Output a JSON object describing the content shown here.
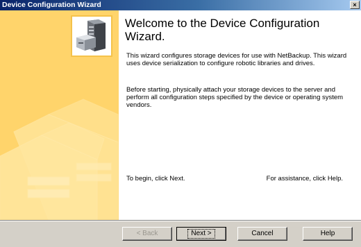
{
  "window": {
    "title": "Device Configuration Wizard",
    "close_label": "×"
  },
  "content": {
    "heading": "Welcome to the Device Configuration Wizard.",
    "paragraph1": "This wizard configures storage devices for use with NetBackup. This wizard uses device serialization to configure robotic libraries and drives.",
    "paragraph2": "Before starting, physically attach your storage devices to the server and perform all configuration steps specified by the device or operating system vendors.",
    "begin_hint": "To begin, click Next.",
    "assist_hint": "For assistance, click Help."
  },
  "buttons": {
    "back": "< Back",
    "next": "Next >",
    "cancel": "Cancel",
    "help": "Help"
  },
  "colors": {
    "sidebar": "#ffd46b",
    "titlebar_start": "#0a246a",
    "titlebar_end": "#a6caf0",
    "footer": "#d4d0c8"
  },
  "icons": {
    "wizard_header": "storage-server-icon"
  }
}
